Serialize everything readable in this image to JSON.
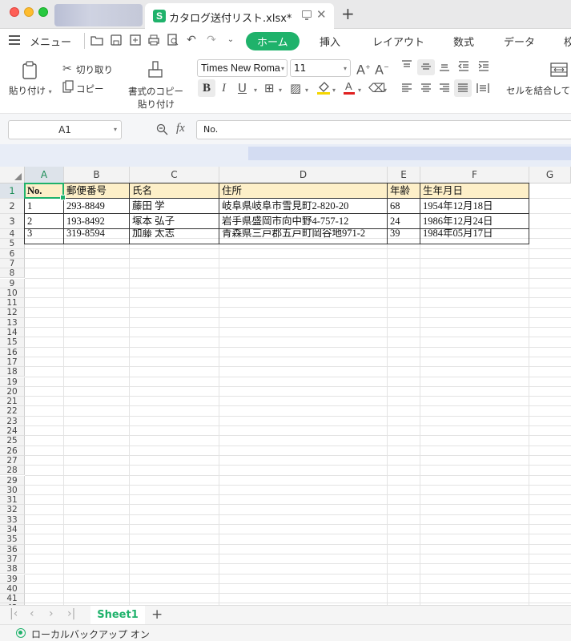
{
  "window": {
    "doc_tab_title": "カタログ送付リスト.xlsx*"
  },
  "menubar": {
    "menu_label": "メニュー",
    "tabs": [
      "ホーム",
      "挿入",
      "レイアウト",
      "数式",
      "データ",
      "校"
    ]
  },
  "ribbon": {
    "paste": "貼り付け",
    "cut": "切り取り",
    "copy": "コピー",
    "format_painter_1": "書式のコピー",
    "format_painter_2": "貼り付け",
    "font_name": "Times New Roma",
    "font_size": "11",
    "merge": "セルを結合して"
  },
  "formula": {
    "cell_ref": "A1",
    "content": "No."
  },
  "columns": [
    "A",
    "B",
    "C",
    "D",
    "E",
    "F",
    "G"
  ],
  "table": {
    "header": [
      "No.",
      "郵便番号",
      "氏名",
      "住所",
      "年齢",
      "生年月日"
    ],
    "rows": [
      [
        "1",
        "293-8849",
        "藤田 学",
        "岐阜県岐阜市雪見町2-820-20",
        "68",
        "1954年12月18日"
      ],
      [
        "2",
        "193-8492",
        "塚本 弘子",
        "岩手県盛岡市向中野4-757-12",
        "24",
        "1986年12月24日"
      ],
      [
        "3",
        "319-8594",
        "加藤 太志",
        "青森県三戸郡五戸町岡谷地971-2",
        "39",
        "1984年05月17日"
      ]
    ]
  },
  "sheets": {
    "active": "Sheet1"
  },
  "status": {
    "backup": "ローカルバックアップ オン"
  },
  "colors": {
    "accent": "#1fb26b",
    "header_fill": "#fdefc8"
  }
}
